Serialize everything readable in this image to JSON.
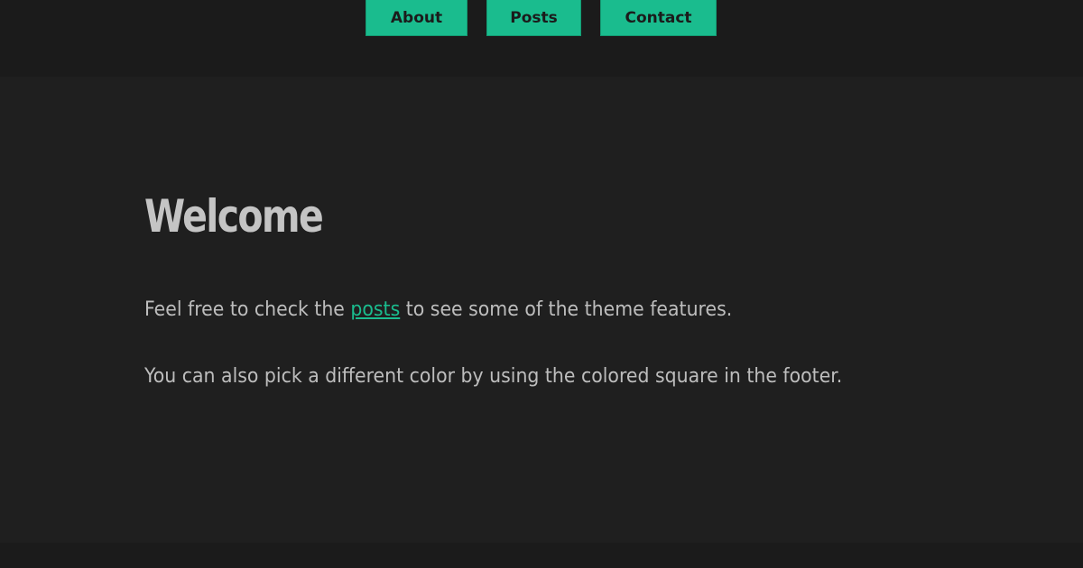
{
  "nav": {
    "items": [
      {
        "label": "About"
      },
      {
        "label": "Posts"
      },
      {
        "label": "Contact"
      }
    ]
  },
  "content": {
    "title": "Welcome",
    "paragraph1": {
      "before": "Feel free to check the ",
      "link_text": "posts",
      "after": " to see some of the theme features."
    },
    "paragraph2": "You can also pick a different color by using the colored square in the footer."
  },
  "colors": {
    "accent": "#1abc8e",
    "background": "#1f1f1f",
    "header_background": "#1b1b1b",
    "text": "#bdbdbd"
  }
}
